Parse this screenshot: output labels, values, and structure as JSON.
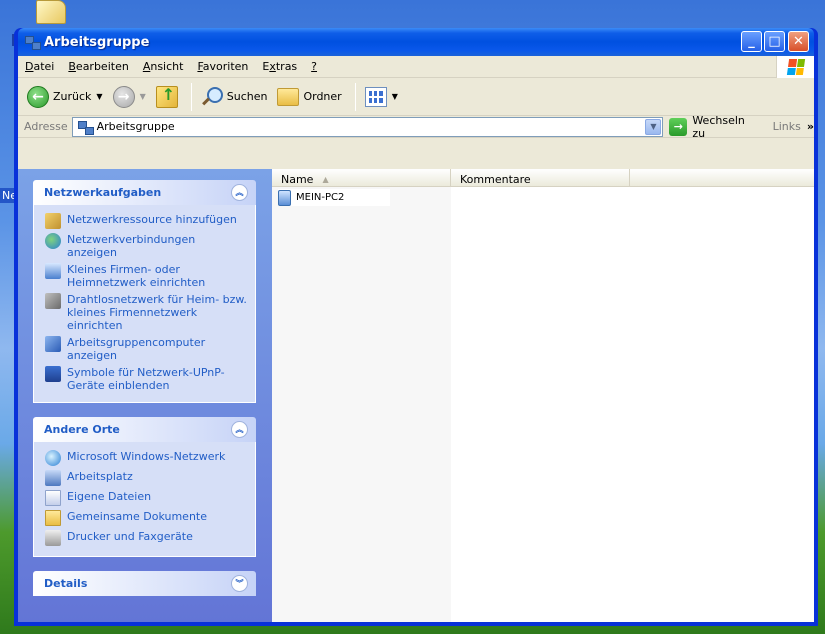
{
  "desktop": {
    "label_fragment": "Ne"
  },
  "window": {
    "title": "Arbeitsgruppe",
    "controls": {
      "minimize": "_",
      "maximize": "□",
      "close": "✕"
    }
  },
  "menu": [
    {
      "pre": "",
      "ul": "D",
      "post": "atei"
    },
    {
      "pre": "",
      "ul": "B",
      "post": "earbeiten"
    },
    {
      "pre": "",
      "ul": "A",
      "post": "nsicht"
    },
    {
      "pre": "",
      "ul": "F",
      "post": "avoriten"
    },
    {
      "pre": "E",
      "ul": "x",
      "post": "tras"
    },
    {
      "pre": "",
      "ul": "?",
      "post": ""
    }
  ],
  "toolbar": {
    "back_label": "Zurück",
    "search_label": "Suchen",
    "folders_label": "Ordner",
    "dropdown_glyph": "▼",
    "back_glyph": "←",
    "forward_glyph": "→"
  },
  "address": {
    "label": "Adresse",
    "value": "Arbeitsgruppe",
    "go_label": "Wechseln zu",
    "go_glyph": "→",
    "links_label": "Links",
    "more_glyph": "»"
  },
  "taskpane": {
    "groups": [
      {
        "title": "Netzwerkaufgaben",
        "chevron": "︽",
        "items": [
          {
            "label": "Netzwerkressource hinzufügen",
            "icon": "add-network-place-icon"
          },
          {
            "label": "Netzwerkverbindungen anzeigen",
            "icon": "network-connections-icon"
          },
          {
            "label": "Kleines Firmen- oder Heimnetzwerk einrichten",
            "icon": "home-network-icon"
          },
          {
            "label": "Drahtlosnetzwerk für Heim- bzw. kleines Firmennetzwerk einrichten",
            "icon": "wireless-network-icon"
          },
          {
            "label": "Arbeitsgruppencomputer anzeigen",
            "icon": "workgroup-computers-icon"
          },
          {
            "label": "Symbole für Netzwerk-UPnP-Geräte einblenden",
            "icon": "upnp-device-icon"
          }
        ]
      },
      {
        "title": "Andere Orte",
        "chevron": "︽",
        "items": [
          {
            "label": "Microsoft Windows-Netzwerk",
            "icon": "windows-network-icon"
          },
          {
            "label": "Arbeitsplatz",
            "icon": "my-computer-icon"
          },
          {
            "label": "Eigene Dateien",
            "icon": "my-documents-icon"
          },
          {
            "label": "Gemeinsame Dokumente",
            "icon": "shared-documents-icon"
          },
          {
            "label": "Drucker und Faxgeräte",
            "icon": "printers-faxes-icon"
          }
        ]
      },
      {
        "title": "Details",
        "chevron": "︾",
        "items": []
      }
    ]
  },
  "filelist": {
    "columns": [
      {
        "label": "Name",
        "sort_glyph": "▲"
      },
      {
        "label": "Kommentare"
      }
    ],
    "rows": [
      {
        "name": "MEIN-PC2",
        "comment": ""
      }
    ]
  }
}
